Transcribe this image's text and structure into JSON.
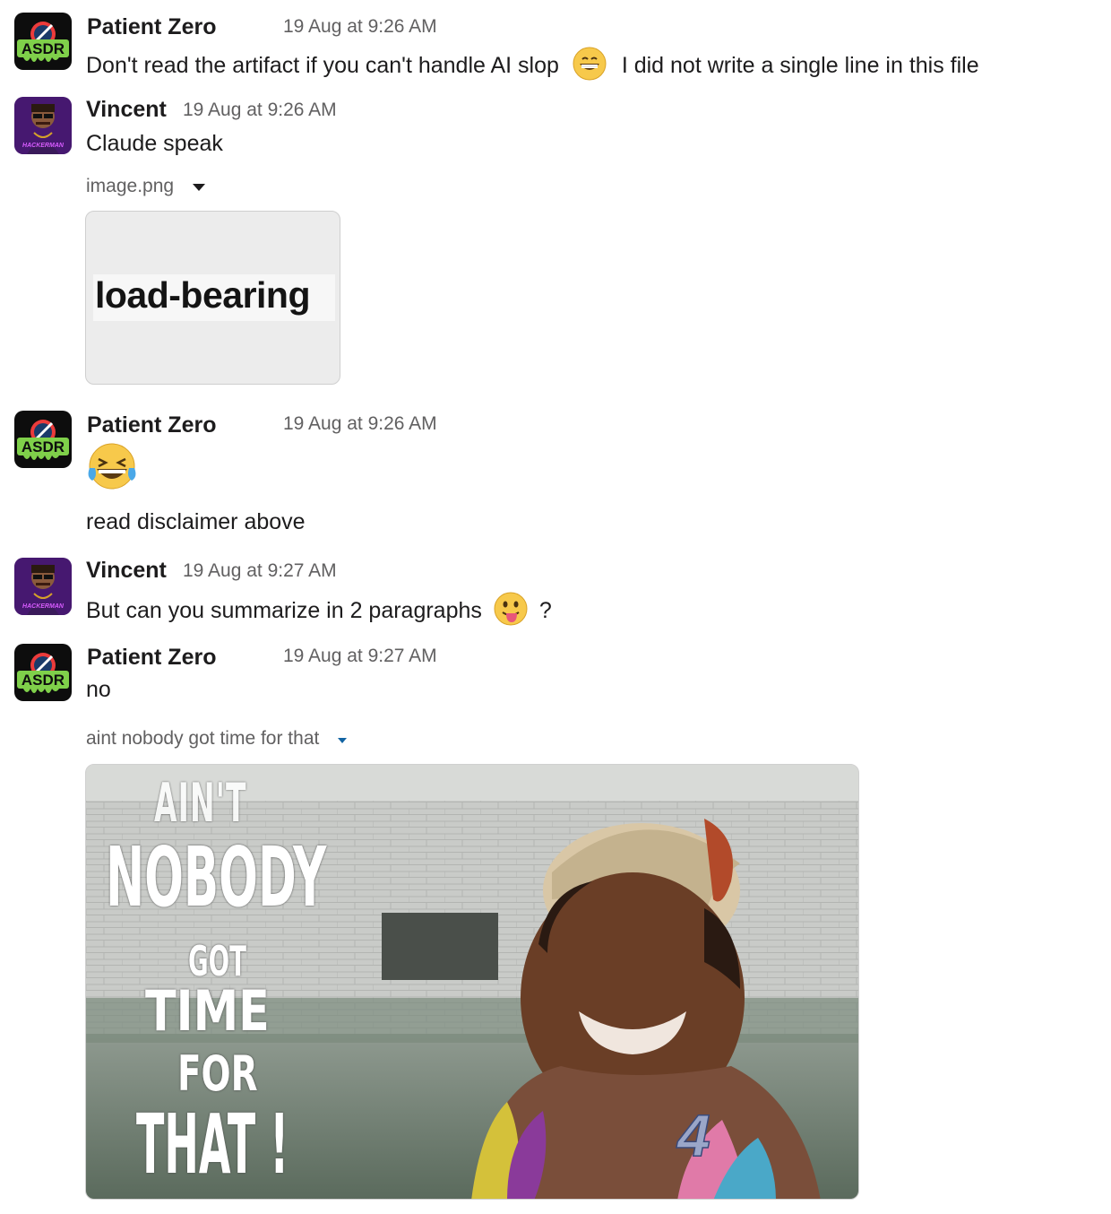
{
  "messages": [
    {
      "author": "Patient Zero",
      "timestamp": "19 Aug at 9:26 AM",
      "avatar_text": "ASDR",
      "text_before": "Don't read the artifact if you can't handle AI slop",
      "emoji": "grinning-face-emoji",
      "text_after": "I did not write a single line in this file"
    },
    {
      "author": "Vincent",
      "timestamp": "19 Aug at 9:26 AM",
      "avatar_text": "HACKERMAN",
      "text": "Claude speak",
      "attachment": {
        "filename": "image.png",
        "image_text": "load-bearing"
      }
    },
    {
      "author": "Patient Zero",
      "timestamp": "19 Aug at 9:26 AM",
      "avatar_text": "ASDR",
      "emoji": "tears-of-joy-emoji",
      "text": "read disclaimer above"
    },
    {
      "author": "Vincent",
      "timestamp": "19 Aug at 9:27 AM",
      "avatar_text": "HACKERMAN",
      "text_before": "But can you summarize in 2 paragraphs",
      "emoji": "tongue-out-emoji",
      "text_after": "?"
    },
    {
      "author": "Patient Zero",
      "timestamp": "19 Aug at 9:27 AM",
      "avatar_text": "ASDR",
      "text": "no",
      "attachment": {
        "filename": "aint nobody got time for that",
        "gif_lines": [
          "AIN'T",
          "NOBODY",
          "GOT",
          "TIME",
          "FOR",
          "THAT !"
        ],
        "watermark": "4"
      }
    }
  ],
  "colors": {
    "text": "#1d1c1d",
    "muted": "#616061",
    "link_caret": "#1264a3",
    "avatar_green": "#7fd04a",
    "avatar_purple": "#5a1f8a"
  }
}
